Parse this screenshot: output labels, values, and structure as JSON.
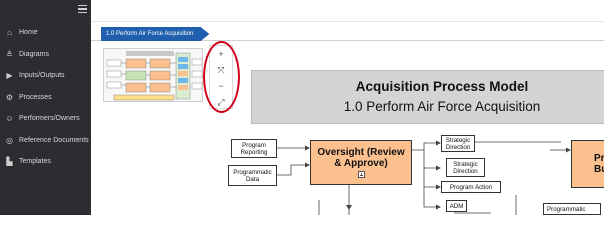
{
  "sidebar": {
    "items": [
      {
        "label": "Home",
        "icon": "home-icon"
      },
      {
        "label": "Diagrams",
        "icon": "diagrams-icon"
      },
      {
        "label": "Inputs/Outputs",
        "icon": "inputs-outputs-icon"
      },
      {
        "label": "Processes",
        "icon": "processes-icon"
      },
      {
        "label": "Performers/Owners",
        "icon": "performers-icon"
      },
      {
        "label": "Reference Documents",
        "icon": "reference-documents-icon"
      },
      {
        "label": "Templates",
        "icon": "templates-icon"
      }
    ]
  },
  "breadcrumb": {
    "label": "1.0 Perform Air Force Acquisition"
  },
  "zoom": {
    "plus": "+",
    "fit": "⤧",
    "minus": "−",
    "expand": "⤢"
  },
  "diagram": {
    "title": "Acquisition Process Model",
    "subtitle": "1.0 Perform Air Force Acquisition",
    "oversight_line1": "Oversight (Review",
    "oversight_line2": "& Approve)",
    "budget_frag1": "Pr",
    "budget_frag2": "Bu",
    "inputs": [
      "Program Reporting",
      "Programmatic Data"
    ],
    "outputs": [
      "Strategic Direction",
      "Strategic Direction",
      "Program Action",
      "ADM"
    ],
    "bottom_right_input": "Programmatic"
  },
  "colors": {
    "sidebar_bg": "#2b2d30",
    "accent_blue": "#1f5fae",
    "highlight_red": "#d0021b",
    "process_orange": "#fbc08e"
  }
}
